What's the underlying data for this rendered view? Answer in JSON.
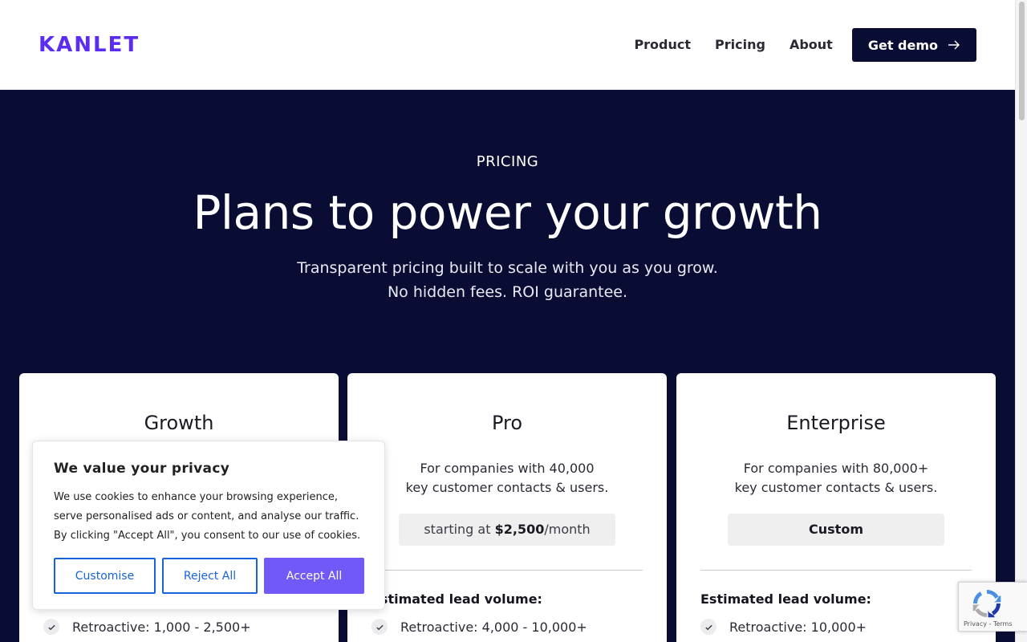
{
  "header": {
    "logo": "KANLET",
    "nav": [
      "Product",
      "Pricing",
      "About"
    ],
    "cta": "Get demo"
  },
  "hero": {
    "eyebrow": "PRICING",
    "title": "Plans to power your growth",
    "subtitle_line1": "Transparent pricing built to scale with you as you grow.",
    "subtitle_line2": "No hidden fees. ROI guarantee."
  },
  "plans": [
    {
      "name": "Growth",
      "desc_line1": "",
      "desc_line2": "",
      "price_prefix": "",
      "price_value": "",
      "price_suffix": "",
      "lead_label": "",
      "feature": "Retroactive: 1,000 - 2,500+"
    },
    {
      "name": "Pro",
      "desc_line1": "For companies with 40,000",
      "desc_line2": "key customer contacts & users.",
      "price_prefix": "starting at ",
      "price_value": "$2,500",
      "price_suffix": "/month",
      "lead_label": "Estimated lead volume:",
      "feature": "Retroactive: 4,000 - 10,000+"
    },
    {
      "name": "Enterprise",
      "desc_line1": "For companies with 80,000+",
      "desc_line2": "key customer contacts & users.",
      "price_prefix": "",
      "price_value": "Custom",
      "price_suffix": "",
      "lead_label": "Estimated lead volume:",
      "feature": "Retroactive: 10,000+"
    }
  ],
  "cookie": {
    "title": "We value your privacy",
    "text": "We use cookies to enhance your browsing experience, serve personalised ads or content, and analyse our traffic. By clicking \"Accept All\", you consent to our use of cookies.",
    "customise": "Customise",
    "reject": "Reject All",
    "accept": "Accept All"
  },
  "recaptcha": {
    "links": "Privacy - Terms"
  },
  "colors": {
    "brand": "#5b2df0",
    "navy": "#0a0d33",
    "cookie_blue": "#1863dc",
    "accept_purple": "#7059f6"
  }
}
